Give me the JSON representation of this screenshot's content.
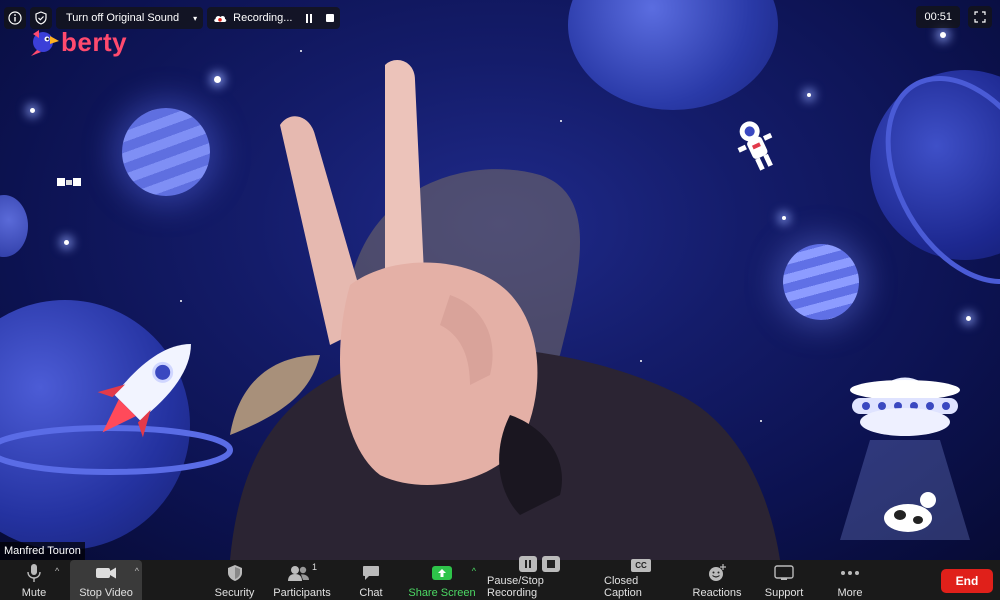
{
  "top_bar": {
    "info_icon": "info-icon",
    "security_icon": "shield-check-icon",
    "original_sound_label": "Turn off Original Sound",
    "recording_label": "Recording...",
    "timer": "00:51"
  },
  "brand": {
    "logo_text": "berty"
  },
  "participant": {
    "name": "Manfred Touron"
  },
  "toolbar": {
    "mute": "Mute",
    "stop_video": "Stop Video",
    "security": "Security",
    "participants": "Participants",
    "participants_count": "1",
    "chat": "Chat",
    "share_screen": "Share Screen",
    "pause_stop_recording": "Pause/Stop Recording",
    "closed_caption": "Closed Caption",
    "cc_badge": "CC",
    "reactions": "Reactions",
    "support": "Support",
    "more": "More",
    "end": "End"
  },
  "colors": {
    "end": "#e0201a",
    "share": "#4cd964",
    "brand": "#ff4a6e"
  }
}
